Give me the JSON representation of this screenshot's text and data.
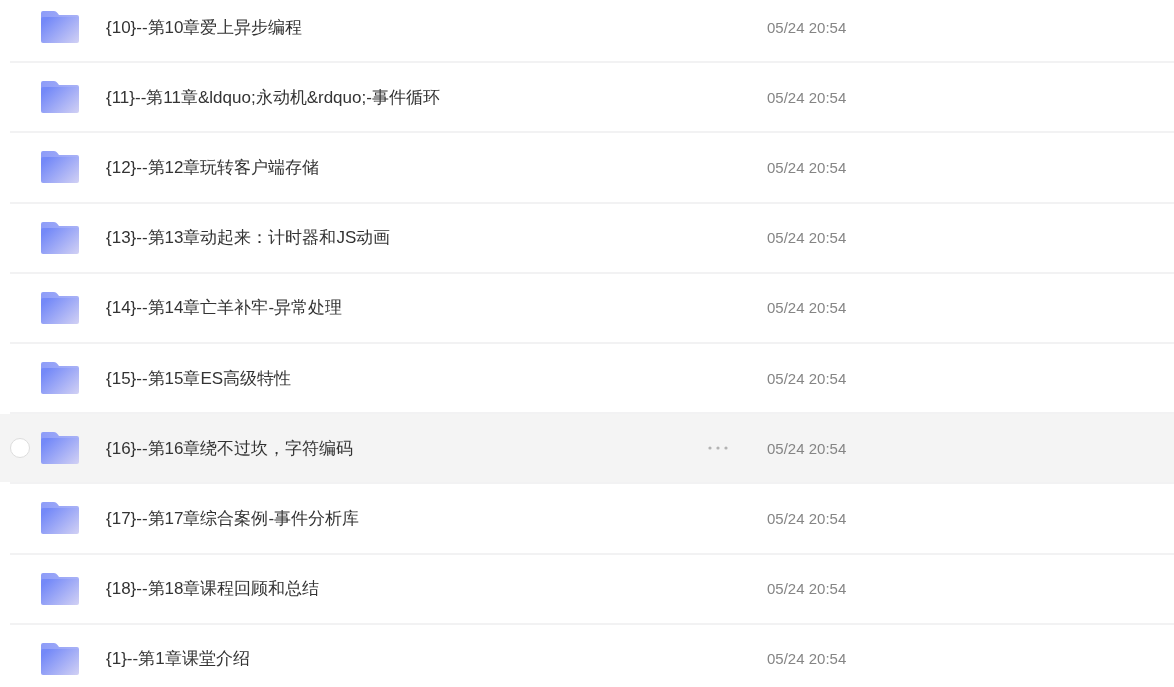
{
  "files": [
    {
      "name": "{10}--第10章爱上异步编程",
      "modified": "05/24 20:54",
      "hovered": false,
      "selected": false
    },
    {
      "name": "{11}--第11章&ldquo;永动机&rdquo;-事件循环",
      "modified": "05/24 20:54",
      "hovered": false,
      "selected": false
    },
    {
      "name": "{12}--第12章玩转客户端存储",
      "modified": "05/24 20:54",
      "hovered": false,
      "selected": false
    },
    {
      "name": "{13}--第13章动起来：计时器和JS动画",
      "modified": "05/24 20:54",
      "hovered": false,
      "selected": false
    },
    {
      "name": "{14}--第14章亡羊补牢-异常处理",
      "modified": "05/24 20:54",
      "hovered": false,
      "selected": false
    },
    {
      "name": "{15}--第15章ES高级特性",
      "modified": "05/24 20:54",
      "hovered": false,
      "selected": false
    },
    {
      "name": "{16}--第16章绕不过坎，字符编码",
      "modified": "05/24 20:54",
      "hovered": true,
      "selected": false
    },
    {
      "name": "{17}--第17章综合案例-事件分析库",
      "modified": "05/24 20:54",
      "hovered": false,
      "selected": false
    },
    {
      "name": "{18}--第18章课程回顾和总结",
      "modified": "05/24 20:54",
      "hovered": false,
      "selected": false
    },
    {
      "name": "{1}--第1章课堂介绍",
      "modified": "05/24 20:54",
      "hovered": false,
      "selected": false
    }
  ]
}
